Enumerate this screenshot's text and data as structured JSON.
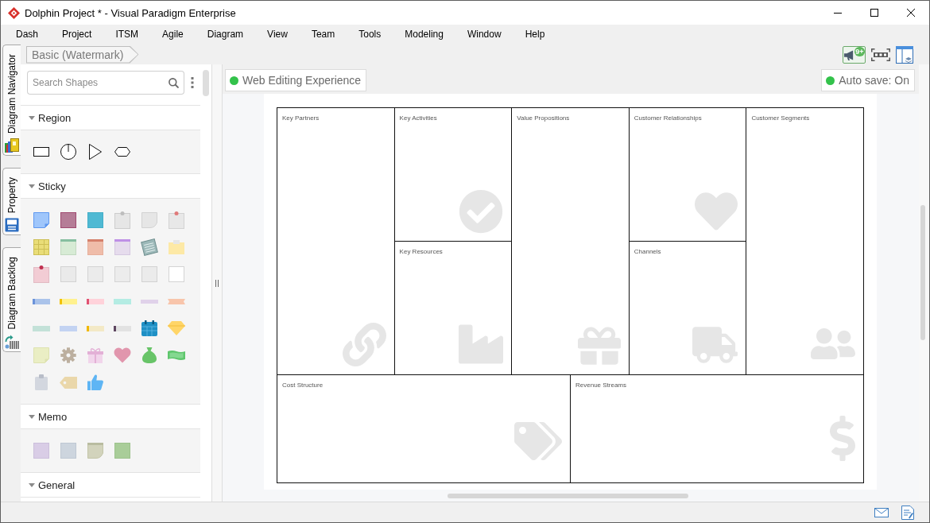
{
  "window": {
    "title": "Dolphin Project * - Visual Paradigm Enterprise"
  },
  "menu": [
    "Dash",
    "Project",
    "ITSM",
    "Agile",
    "Diagram",
    "View",
    "Team",
    "Tools",
    "Modeling",
    "Window",
    "Help"
  ],
  "side_tabs": [
    {
      "label": "Diagram Navigator"
    },
    {
      "label": "Property"
    },
    {
      "label": "Diagram Backlog"
    }
  ],
  "breadcrumb": {
    "label": "Basic (Watermark)"
  },
  "toolbar": {
    "notification_badge": "9+"
  },
  "palette": {
    "search": {
      "placeholder": "Search Shapes"
    },
    "sections": [
      {
        "title": "Region",
        "kind": "region",
        "expanded": true
      },
      {
        "title": "Sticky",
        "kind": "sticky",
        "expanded": true
      },
      {
        "title": "Memo",
        "kind": "memo",
        "expanded": true
      },
      {
        "title": "General",
        "kind": "general",
        "expanded": true
      }
    ]
  },
  "diagram": {
    "web_editing": {
      "label": "Web Editing Experience"
    },
    "auto_save": {
      "label": "Auto save: On"
    },
    "blocks": [
      {
        "label": "Key Partners"
      },
      {
        "label": "Key Activities"
      },
      {
        "label": "Value Propositions"
      },
      {
        "label": "Customer Relationships"
      },
      {
        "label": "Customer Segments"
      },
      {
        "label": "Key Resources"
      },
      {
        "label": "Channels"
      },
      {
        "label": "Cost Structure"
      },
      {
        "label": "Revenue Streams"
      }
    ]
  }
}
